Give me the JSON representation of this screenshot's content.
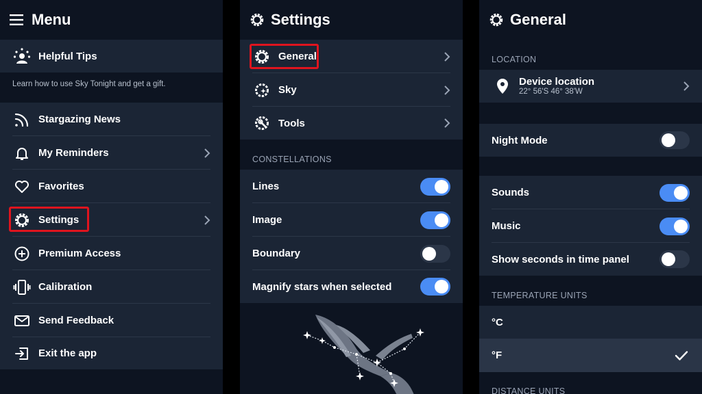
{
  "menu": {
    "title": "Menu",
    "tips": {
      "label": "Helpful Tips",
      "description": "Learn how to use Sky Tonight and get a gift."
    },
    "items": [
      {
        "label": "Stargazing News",
        "icon": "rss-icon"
      },
      {
        "label": "My Reminders",
        "icon": "bell-icon",
        "chevron": true
      },
      {
        "label": "Favorites",
        "icon": "heart-icon"
      },
      {
        "label": "Settings",
        "icon": "gear-icon",
        "chevron": true,
        "highlighted": true
      },
      {
        "label": "Premium Access",
        "icon": "plus-circle-icon"
      },
      {
        "label": "Calibration",
        "icon": "phone-vibrate-icon"
      },
      {
        "label": "Send Feedback",
        "icon": "envelope-icon"
      },
      {
        "label": "Exit the app",
        "icon": "exit-icon"
      }
    ]
  },
  "settings": {
    "title": "Settings",
    "items": [
      {
        "label": "General",
        "icon": "gear-icon",
        "highlighted": true
      },
      {
        "label": "Sky",
        "icon": "gear-star-icon"
      },
      {
        "label": "Tools",
        "icon": "gear-wrench-icon"
      }
    ],
    "constellations": {
      "section": "CONSTELLATIONS",
      "toggles": [
        {
          "label": "Lines",
          "on": true
        },
        {
          "label": "Image",
          "on": true
        },
        {
          "label": "Boundary",
          "on": false
        },
        {
          "label": "Magnify stars when selected",
          "on": true
        }
      ]
    }
  },
  "general": {
    "title": "General",
    "location": {
      "section": "LOCATION",
      "label": "Device location",
      "coords": "22° 56'S 46° 38'W"
    },
    "night_mode": {
      "label": "Night Mode",
      "on": false
    },
    "sound_toggles": [
      {
        "label": "Sounds",
        "on": true
      },
      {
        "label": "Music",
        "on": true
      },
      {
        "label": "Show seconds in time panel",
        "on": false
      }
    ],
    "temperature": {
      "section": "TEMPERATURE UNITS",
      "options": [
        {
          "label": "°C",
          "selected": false
        },
        {
          "label": "°F",
          "selected": true
        }
      ]
    },
    "distance": {
      "section": "DISTANCE UNITS"
    }
  },
  "colors": {
    "background": "#0d1421",
    "row": "#1b2535",
    "toggle_on": "#4a8cf4",
    "highlight": "#e0141e"
  }
}
